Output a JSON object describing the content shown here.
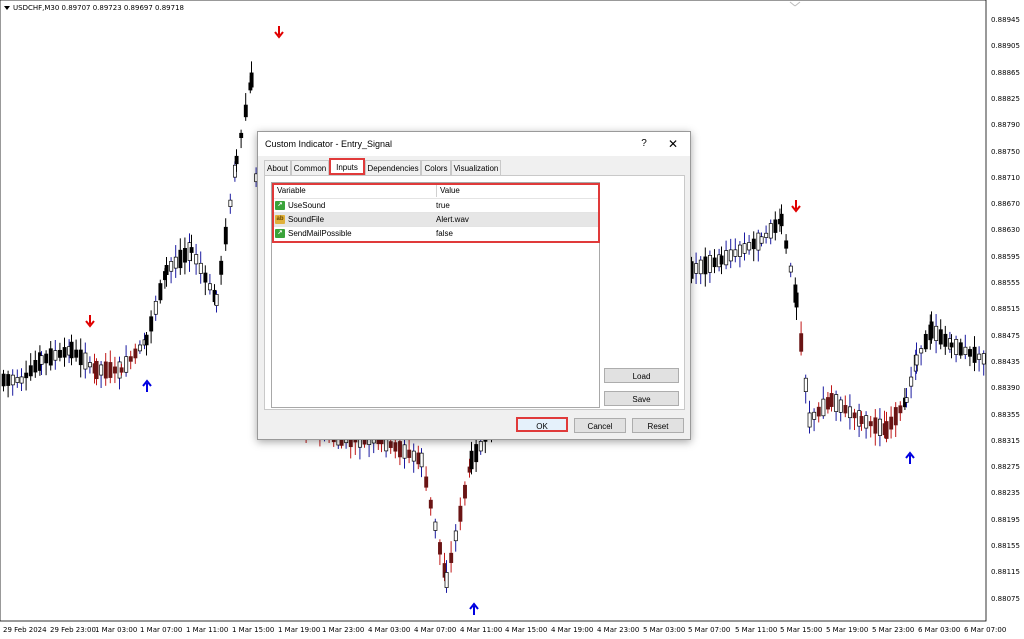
{
  "chart": {
    "symbol_header": "USDCHF,M30  0.89707 0.89723 0.89697 0.89718",
    "price_labels": [
      "0.88945",
      "0.88905",
      "0.88865",
      "0.88825",
      "0.88790",
      "0.88750",
      "0.88710",
      "0.88670",
      "0.88630",
      "0.88595",
      "0.88555",
      "0.88515",
      "0.88475",
      "0.88435",
      "0.88390",
      "0.88355",
      "0.88315",
      "0.88275",
      "0.88235",
      "0.88195",
      "0.88155",
      "0.88115",
      "0.88075"
    ],
    "time_labels": [
      "29 Feb 2024",
      "29 Feb 23:00",
      "1 Mar 03:00",
      "1 Mar 07:00",
      "1 Mar 11:00",
      "1 Mar 15:00",
      "1 Mar 19:00",
      "1 Mar 23:00",
      "4 Mar 03:00",
      "4 Mar 07:00",
      "4 Mar 11:00",
      "4 Mar 15:00",
      "4 Mar 19:00",
      "4 Mar 23:00",
      "5 Mar 03:00",
      "5 Mar 07:00",
      "5 Mar 11:00",
      "5 Mar 15:00",
      "5 Mar 19:00",
      "5 Mar 23:00",
      "6 Mar 03:00",
      "6 Mar 07:00"
    ],
    "colors": {
      "bull": "#ffffff",
      "bull_wick": "#1a1aa0",
      "bear": "#000000",
      "bear_red": "#8b1a1a",
      "sell_arrow": "#e00000",
      "buy_arrow": "#0000e0"
    }
  },
  "dialog": {
    "title": "Custom Indicator - Entry_Signal",
    "help_glyph": "?",
    "close_glyph": "✕",
    "tabs": [
      {
        "label": "About"
      },
      {
        "label": "Common"
      },
      {
        "label": "Inputs",
        "active": true
      },
      {
        "label": "Dependencies"
      },
      {
        "label": "Colors"
      },
      {
        "label": "Visualization"
      }
    ],
    "table": {
      "col_variable": "Variable",
      "col_value": "Value",
      "rows": [
        {
          "icon": "bool-icon",
          "variable": "UseSound",
          "value": "true"
        },
        {
          "icon": "string-icon",
          "variable": "SoundFile",
          "value": "Alert.wav"
        },
        {
          "icon": "bool-icon",
          "variable": "SendMailPossible",
          "value": "false"
        }
      ],
      "icon_glyphs": {
        "bool": "↗",
        "string": "ab"
      }
    },
    "buttons": {
      "load": "Load",
      "save": "Save",
      "ok": "OK",
      "cancel": "Cancel",
      "reset": "Reset"
    }
  }
}
